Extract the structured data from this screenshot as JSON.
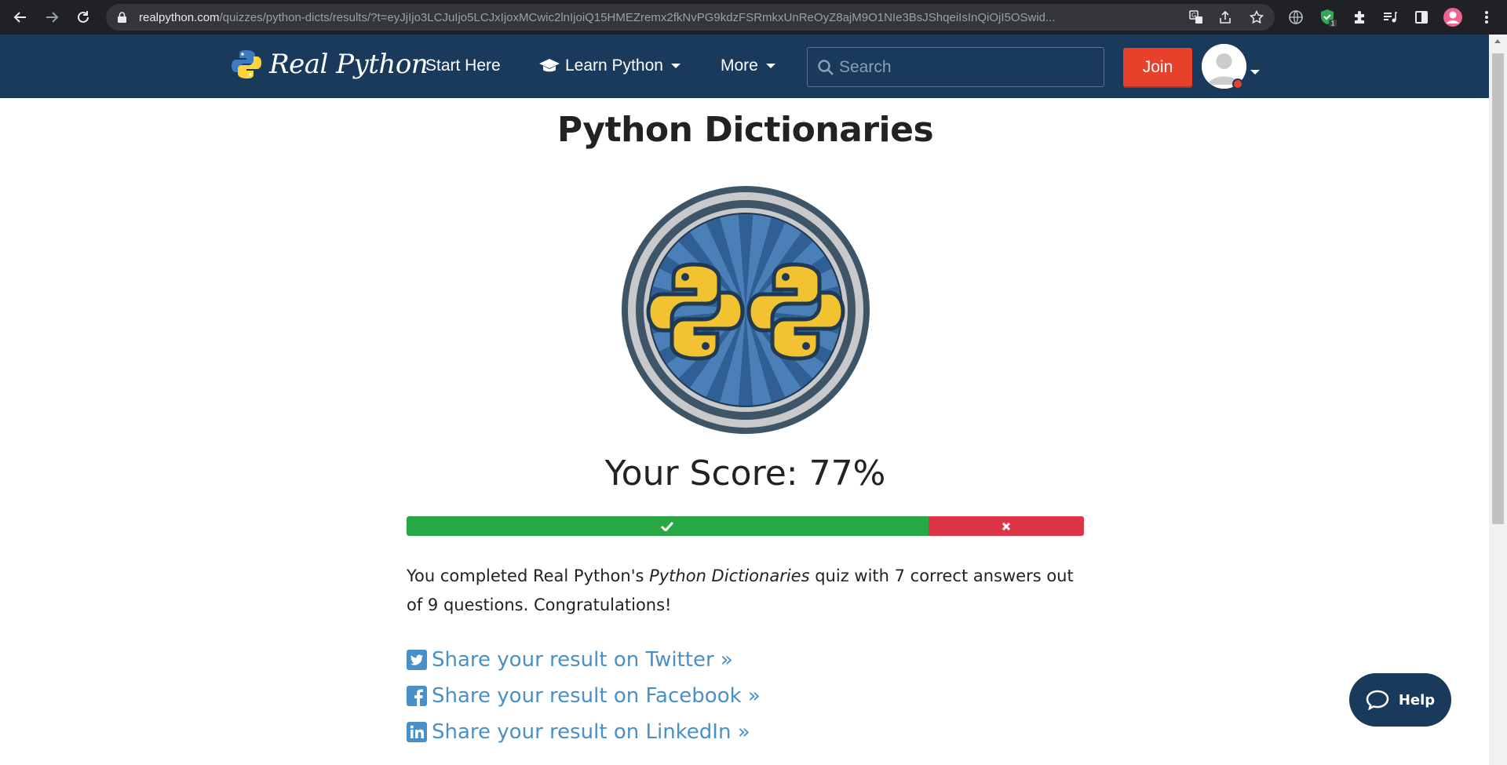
{
  "browser": {
    "url_host": "realpython.com",
    "url_path": "/quizzes/python-dicts/results/?t=eyJjIjo3LCJuIjo5LCJxIjoxMCwic2lnIjoiQ15HMEZremx2fkNvPG9kdzFSRmkxUnReOyZ8ajM9O1NIe3BsJShqeiIsInQiOjI5OSwid...",
    "extension_badge": "1"
  },
  "header": {
    "logo_text": "Real Python",
    "nav": {
      "start_here": "Start Here",
      "learn_python": "Learn Python",
      "more": "More"
    },
    "search_placeholder": "Search",
    "join_label": "Join"
  },
  "quiz": {
    "title": "Python Dictionaries",
    "score_text": "Your Score: 77%",
    "score_percent": 77,
    "summary": {
      "before": "You completed Real Python's ",
      "quiz_name": "Python Dictionaries",
      "after": " quiz with 7 correct answers out of 9 questions. Congratulations!"
    },
    "share": {
      "twitter": "Share your result on Twitter »",
      "facebook": "Share your result on Facebook »",
      "linkedin": "Share your result on LinkedIn »"
    }
  },
  "help": {
    "label": "Help"
  },
  "colors": {
    "header_bg": "#1a3a5c",
    "join_bg": "#e8402a",
    "correct": "#28a745",
    "wrong": "#dc3545",
    "link": "#4a90c8"
  }
}
